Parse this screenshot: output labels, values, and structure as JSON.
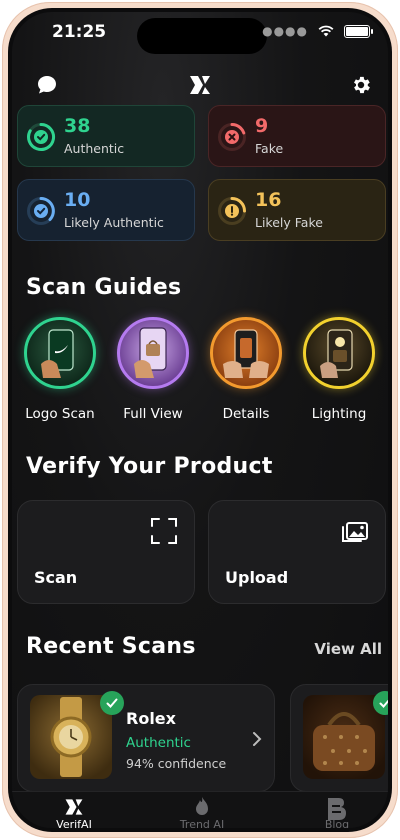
{
  "status": {
    "time": "21:25"
  },
  "stats": [
    {
      "value": "38",
      "label": "Authentic",
      "color": "#2fd38f"
    },
    {
      "value": "9",
      "label": "Fake",
      "color": "#f26a6a"
    },
    {
      "value": "10",
      "label": "Likely Authentic",
      "color": "#6aaef2"
    },
    {
      "value": "16",
      "label": "Likely Fake",
      "color": "#f3c25a"
    }
  ],
  "guides": {
    "title": "Scan Guides",
    "items": [
      {
        "label": "Logo Scan",
        "color": "#2fd38f"
      },
      {
        "label": "Full View",
        "color": "#b57bf0"
      },
      {
        "label": "Details",
        "color": "#f39a2e"
      },
      {
        "label": "Lighting",
        "color": "#f2d12e"
      }
    ]
  },
  "verify": {
    "title": "Verify Your Product",
    "scan_label": "Scan",
    "upload_label": "Upload"
  },
  "recent": {
    "title": "Recent Scans",
    "view_all": "View All",
    "items": [
      {
        "brand": "Rolex",
        "status": "Authentic",
        "confidence": "94% confidence",
        "status_color": "#2fd38f"
      }
    ]
  },
  "tabs": [
    {
      "label": "VerifAI",
      "active": true
    },
    {
      "label": "Trend AI",
      "active": false
    },
    {
      "label": "Blog",
      "active": false
    }
  ]
}
